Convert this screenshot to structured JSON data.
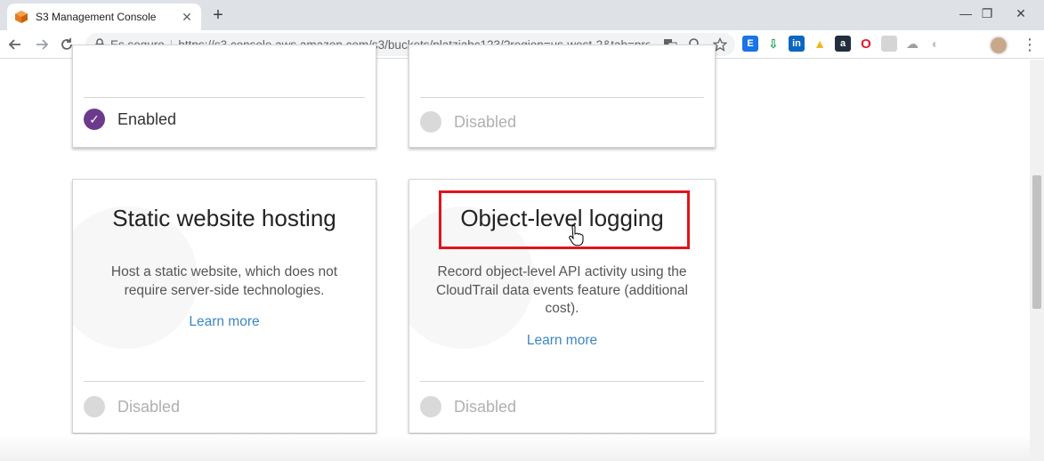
{
  "browser": {
    "tab_title": "S3 Management Console",
    "tab_close": "✕",
    "new_tab": "+",
    "window_controls": {
      "minimize": "—",
      "restore": "❐",
      "close": "✕"
    },
    "secure_label": "Es seguro",
    "url": "https://s3.console.aws.amazon.com/s3/buckets/platziabc123/?region=us-west-2&tab=prop...",
    "icons": [
      "back-icon",
      "forward-icon",
      "reload-icon",
      "lock-icon",
      "translate-icon",
      "zoom-icon",
      "star-icon",
      "menu-icon"
    ],
    "extensions": [
      {
        "name": "extension-e",
        "glyph": "E",
        "color": "#1a73e8"
      },
      {
        "name": "extension-download",
        "glyph": "↓",
        "color": "#1e9a55"
      },
      {
        "name": "linkedin",
        "glyph": "in",
        "color": "#0a66c2"
      },
      {
        "name": "extension-triangle",
        "glyph": "▲",
        "color": "#f2b71f"
      },
      {
        "name": "amazon",
        "glyph": "a",
        "color": "#232f3e"
      },
      {
        "name": "opera",
        "glyph": "O",
        "color": "#e11d2a"
      },
      {
        "name": "extension-doc",
        "glyph": "▯",
        "color": "#c2c2c2"
      },
      {
        "name": "extension-cloud",
        "glyph": "☁",
        "color": "#9aa0a6"
      },
      {
        "name": "extension-circle",
        "glyph": "◐",
        "color": "#bdc1c6"
      }
    ]
  },
  "cards_top": {
    "left_status": "Enabled",
    "right_status": "Disabled"
  },
  "cards": [
    {
      "title": "Static website hosting",
      "description": "Host a static website, which does not require server-side technologies.",
      "link": "Learn more",
      "status": "Disabled"
    },
    {
      "title": "Object-level logging",
      "description": "Record object-level API activity using the CloudTrail data events feature (additional cost).",
      "link": "Learn more",
      "status": "Disabled"
    }
  ],
  "colors": {
    "enabled_radio": "#6b3a8c",
    "link": "#3b87c4",
    "highlight": "#e0141c",
    "aws_orange": "#e8791e"
  }
}
